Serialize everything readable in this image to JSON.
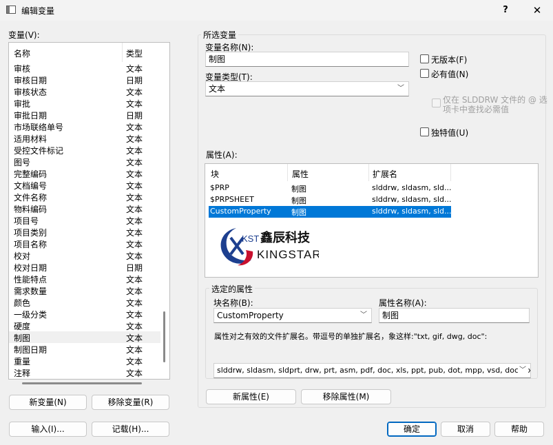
{
  "window": {
    "title": "编辑变量",
    "help_btn": "?",
    "close_btn": "✕"
  },
  "variables": {
    "label": "变量",
    "label_key": "(V):",
    "headers": {
      "name": "名称",
      "type": "类型"
    },
    "rows": [
      {
        "name": "审核",
        "type": "文本"
      },
      {
        "name": "审核日期",
        "type": "日期"
      },
      {
        "name": "审核状态",
        "type": "文本"
      },
      {
        "name": "审批",
        "type": "文本"
      },
      {
        "name": "审批日期",
        "type": "日期"
      },
      {
        "name": "市场联络单号",
        "type": "文本"
      },
      {
        "name": "适用材料",
        "type": "文本"
      },
      {
        "name": "受控文件标记",
        "type": "文本"
      },
      {
        "name": "图号",
        "type": "文本"
      },
      {
        "name": "完整编码",
        "type": "文本"
      },
      {
        "name": "文档编号",
        "type": "文本"
      },
      {
        "name": "文件名称",
        "type": "文本"
      },
      {
        "name": "物料编码",
        "type": "文本"
      },
      {
        "name": "项目号",
        "type": "文本"
      },
      {
        "name": "项目类别",
        "type": "文本"
      },
      {
        "name": "项目名称",
        "type": "文本"
      },
      {
        "name": "校对",
        "type": "文本"
      },
      {
        "name": "校对日期",
        "type": "日期"
      },
      {
        "name": "性能特点",
        "type": "文本"
      },
      {
        "name": "需求数量",
        "type": "文本"
      },
      {
        "name": "颜色",
        "type": "文本"
      },
      {
        "name": "一级分类",
        "type": "文本"
      },
      {
        "name": "硬度",
        "type": "文本"
      },
      {
        "name": "制图",
        "type": "文本"
      },
      {
        "name": "制图日期",
        "type": "文本"
      },
      {
        "name": "重量",
        "type": "文本"
      },
      {
        "name": "注释",
        "type": "文本"
      }
    ],
    "new_btn": "新变量(N)",
    "remove_btn": "移除变量(R)",
    "import_btn": "输入(I)...",
    "record_btn": "记载(H)..."
  },
  "selected": {
    "group_label": "所选变量",
    "name_label": "变量名称(N):",
    "name_value": "制图",
    "type_label": "变量类型(T):",
    "type_value": "文本",
    "no_version": "无版本(F)",
    "required": "必有值(N)",
    "search_line1": "仅在 SLDDRW 文件的 @ 选",
    "search_line2": "项卡中查找必需值",
    "unique": "独特值(U)"
  },
  "attributes": {
    "label": "属性(A):",
    "headers": {
      "block": "块",
      "attr": "属性",
      "ext": "扩展名"
    },
    "rows": [
      {
        "block": "$PRP",
        "attr": "制图",
        "ext": "slddrw, sldasm, sld..."
      },
      {
        "block": "$PRPSHEET",
        "attr": "制图",
        "ext": "slddrw, sldasm, sld..."
      },
      {
        "block": "CustomProperty",
        "attr": "制图",
        "ext": "slddrw, sldasm, sld..."
      }
    ],
    "logo_kst": "KST",
    "logo_cn": "鑫辰科技",
    "logo_en": "KINGSTAR",
    "new_btn": "新属性(E)",
    "remove_btn": "移除属性(M)"
  },
  "selected_attr": {
    "group_label": "选定的属性",
    "block_label": "块名称(B):",
    "block_value": "CustomProperty",
    "attr_label": "属性名称(A):",
    "attr_value": "制图",
    "ext_desc": "属性对之有效的文件扩展名。带逗号的单独扩展名，象这样:\"txt, gif, dwg, doc\":",
    "ext_value": "slddrw, sldasm, sldprt, drw, prt, asm, pdf, doc, xls, ppt, pub, dot, mpp, vsd, docx, xlsx, ppt"
  },
  "footer": {
    "ok": "确定",
    "cancel": "取消",
    "help": "帮助"
  }
}
